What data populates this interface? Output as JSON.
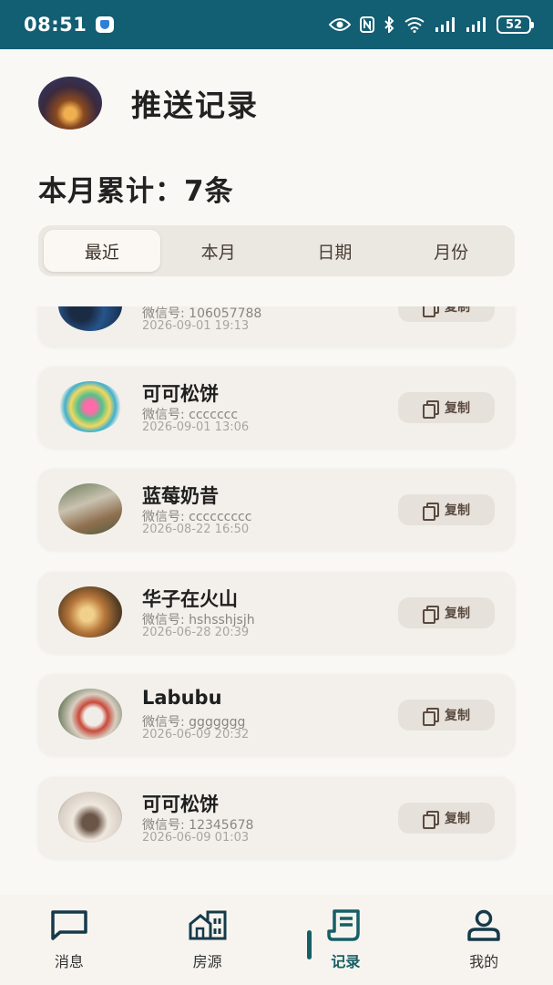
{
  "status_bar": {
    "time": "08:51",
    "battery": "52"
  },
  "header": {
    "title": "推送记录"
  },
  "summary": {
    "text": "本月累计：7条"
  },
  "tabs": [
    {
      "label": "最近",
      "active": true
    },
    {
      "label": "本月",
      "active": false
    },
    {
      "label": "日期",
      "active": false
    },
    {
      "label": "月份",
      "active": false
    }
  ],
  "records": [
    {
      "name": "",
      "wechat": "微信号: 106057788",
      "time": "2026-09-01 19:13",
      "copy": "复制"
    },
    {
      "name": "可可松饼",
      "wechat": "微信号: ccccccc",
      "time": "2026-09-01 13:06",
      "copy": "复制"
    },
    {
      "name": "蓝莓奶昔",
      "wechat": "微信号: ccccccccc",
      "time": "2026-08-22 16:50",
      "copy": "复制"
    },
    {
      "name": "华子在火山",
      "wechat": "微信号: hshsshjsjh",
      "time": "2026-06-28 20:39",
      "copy": "复制"
    },
    {
      "name": "Labubu",
      "wechat": "微信号: ggggggg",
      "time": "2026-06-09 20:32",
      "copy": "复制"
    },
    {
      "name": "可可松饼",
      "wechat": "微信号: 12345678",
      "time": "2026-06-09 01:03",
      "copy": "复制"
    }
  ],
  "bottom_nav": [
    {
      "label": "消息",
      "icon": "message-icon",
      "active": false
    },
    {
      "label": "房源",
      "icon": "buildings-icon",
      "active": false
    },
    {
      "label": "记录",
      "icon": "record-icon",
      "active": true
    },
    {
      "label": "我的",
      "icon": "user-icon",
      "active": false
    }
  ],
  "colors": {
    "status_bar": "#125e72",
    "accent": "#175f66",
    "background": "#faf8f4"
  }
}
